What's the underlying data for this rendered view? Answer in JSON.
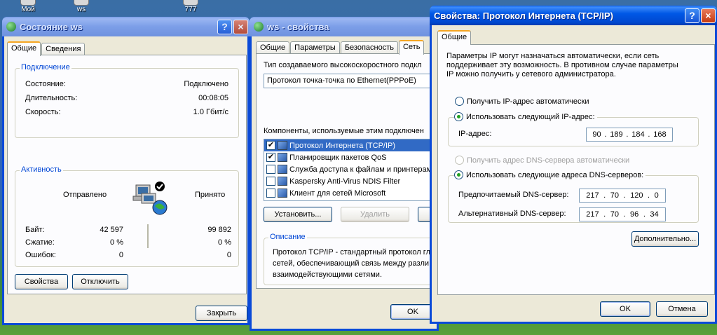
{
  "desktop": {
    "icons": [
      {
        "label": "Мой"
      },
      {
        "label": "ws"
      },
      {
        "label": "777"
      }
    ]
  },
  "status_window": {
    "title": "Состояние ws",
    "help_button": "?",
    "close_button": "×",
    "tabs": [
      {
        "label": "Общие"
      },
      {
        "label": "Сведения"
      }
    ],
    "connection_group": {
      "title": "Подключение",
      "rows": [
        {
          "label": "Состояние:",
          "value": "Подключено"
        },
        {
          "label": "Длительность:",
          "value": "00:08:05"
        },
        {
          "label": "Скорость:",
          "value": "1.0 Гбит/с"
        }
      ]
    },
    "activity_group": {
      "title": "Активность",
      "sent_label": "Отправлено",
      "received_label": "Принято",
      "rows": [
        {
          "label": "Байт:",
          "sent": "42 597",
          "received": "99 892"
        },
        {
          "label": "Сжатие:",
          "sent": "0 %",
          "received": "0 %"
        },
        {
          "label": "Ошибок:",
          "sent": "0",
          "received": "0"
        }
      ]
    },
    "properties_button": "Свойства",
    "disconnect_button": "Отключить",
    "close_label": "Закрыть"
  },
  "props_window": {
    "title": "ws - свойства",
    "tabs": [
      {
        "label": "Общие"
      },
      {
        "label": "Параметры"
      },
      {
        "label": "Безопасность"
      },
      {
        "label": "Сеть"
      }
    ],
    "connection_type_label": "Тип создаваемого высокоскоростного подкл",
    "connection_type_value": "Протокол точка-точка по Ethernet(PPPoE)",
    "components_label": "Компоненты, используемые этим подключен",
    "components": [
      {
        "checked": "✔",
        "label": "Протокол Интернета (TCP/IP)"
      },
      {
        "checked": "✔",
        "label": "Планировщик пакетов QoS"
      },
      {
        "checked": "",
        "label": "Служба доступа к файлам и принтерам"
      },
      {
        "checked": "",
        "label": "Kaspersky Anti-Virus NDIS Filter"
      },
      {
        "checked": "",
        "label": "Клиент для сетей Microsoft"
      }
    ],
    "install_button": "Установить...",
    "remove_button": "Удалить",
    "description_group": {
      "title": "Описание",
      "text_lines": [
        "Протокол TCP/IP - стандартный протокол гл",
        "сетей, обеспечивающий связь между разли",
        "взаимодействующими сетями."
      ]
    },
    "ok_button": "OK"
  },
  "tcpip_window": {
    "title": "Свойства: Протокол Интернета (TCP/IP)",
    "help_button": "?",
    "close_button": "×",
    "tabs": [
      {
        "label": "Общие"
      }
    ],
    "intro_lines": [
      "Параметры IP могут назначаться автоматически, если сеть",
      "поддерживает эту возможность. В противном случае параметры",
      "IP можно получить у сетевого администратора."
    ],
    "ip_auto_label": "Получить IP-адрес автоматически",
    "ip_manual_label": "Использовать следующий IP-адрес:",
    "ip_address_label": "IP-адрес:",
    "ip_address": [
      "90",
      "189",
      "184",
      "168"
    ],
    "dns_auto_label": "Получить адрес DNS-сервера автоматически",
    "dns_manual_label": "Использовать следующие адреса DNS-серверов:",
    "preferred_dns_label": "Предпочитаемый DNS-сервер:",
    "preferred_dns": [
      "217",
      "70",
      "120",
      "0"
    ],
    "alternate_dns_label": "Альтернативный DNS-сервер:",
    "alternate_dns": [
      "217",
      "70",
      "96",
      "34"
    ],
    "advanced_button": "Дополнительно...",
    "ok_button": "OK",
    "cancel_button": "Отмена"
  },
  "colors": {
    "title_active": "#0058e6",
    "title_inactive": "#7c9ee8",
    "window_face": "#ece9d8",
    "group_title": "#0046d5",
    "selection": "#316ac5"
  }
}
